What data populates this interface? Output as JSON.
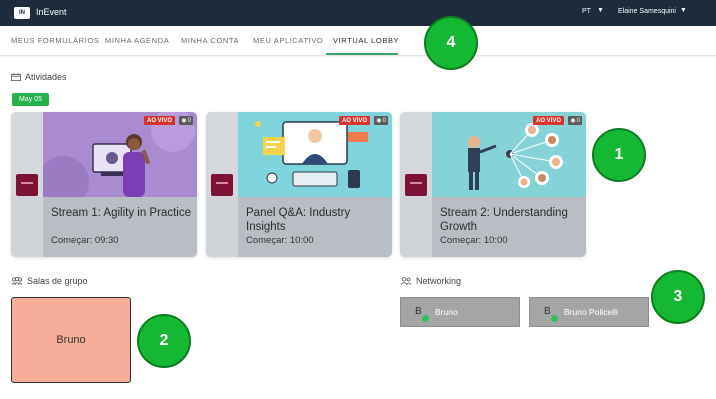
{
  "topbar": {
    "logo_text": "IN",
    "brand": "InEvent",
    "language": "PT",
    "user_name": "Elaine Samesquini"
  },
  "tabs": [
    {
      "label": "MEUS FORMULÁRIOS"
    },
    {
      "label": "MINHA AGENDA"
    },
    {
      "label": "MINHA CONTA"
    },
    {
      "label": "MEU APLICATIVO"
    },
    {
      "label": "VIRTUAL LOBBY",
      "active": true
    }
  ],
  "activities": {
    "title": "Atividades",
    "date": "May 05",
    "cards": [
      {
        "title": "Stream 1: Agility in Practice",
        "start": "Começar: 09:30",
        "live": "AO VIVO",
        "views": "0"
      },
      {
        "title": "Panel Q&A: Industry Insights",
        "start": "Começar: 10:00",
        "live": "AO VIVO",
        "views": "0"
      },
      {
        "title": "Stream 2: Understanding Growth",
        "start": "Começar: 10:00",
        "live": "AO VIVO",
        "views": "0"
      }
    ]
  },
  "group_rooms": {
    "title": "Salas de grupo",
    "rooms": [
      {
        "name": "Bruno"
      }
    ]
  },
  "networking": {
    "title": "Networking",
    "people": [
      {
        "initial": "B",
        "name": "Bruno"
      },
      {
        "initial": "B",
        "name": "Bruno Policelli"
      }
    ]
  },
  "callouts": [
    "1",
    "2",
    "3",
    "4"
  ],
  "colors": {
    "topbar": "#1d2b3a",
    "accent_green": "#25b04a",
    "live_red": "#d9342b",
    "room_salmon": "#f6ad99"
  }
}
